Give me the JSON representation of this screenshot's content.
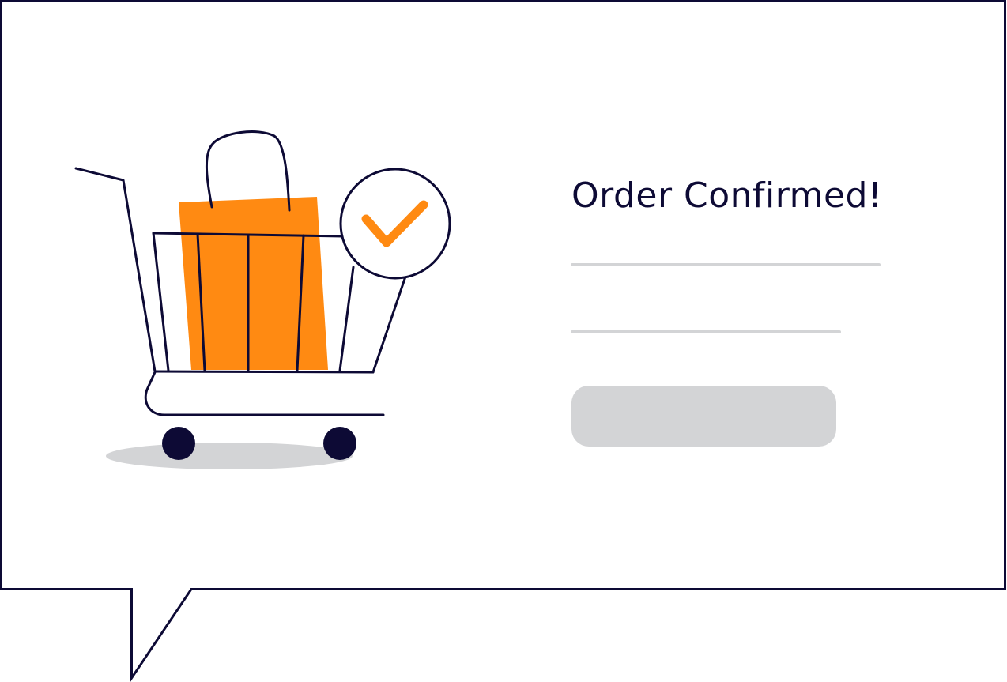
{
  "confirmation": {
    "title": "Order Confirmed!"
  },
  "icons": {
    "illustration": "shopping-cart-icon",
    "bag": "shopping-bag-icon",
    "badge": "check-circle-icon"
  },
  "colors": {
    "ink": "#0d0a35",
    "accent": "#ff8a12",
    "placeholder": "#d3d4d6",
    "background": "#ffffff"
  }
}
